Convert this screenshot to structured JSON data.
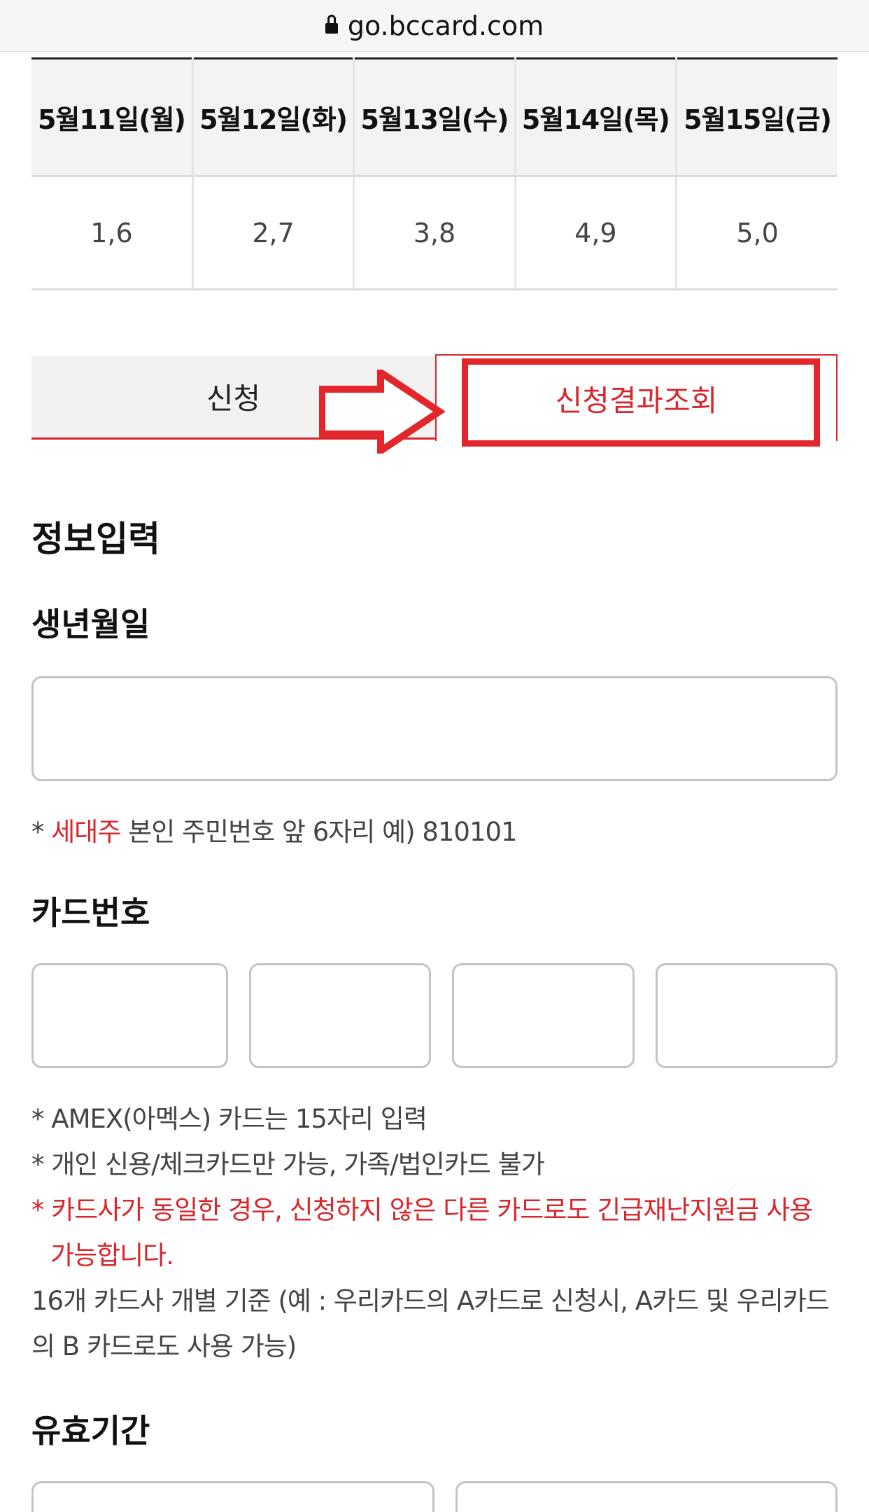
{
  "browser": {
    "url": "go.bccard.com"
  },
  "schedule": {
    "headers": [
      "5월11일(월)",
      "5월12일(화)",
      "5월13일(수)",
      "5월14일(목)",
      "5월15일(금)"
    ],
    "values": [
      "1,6",
      "2,7",
      "3,8",
      "4,9",
      "5,0"
    ]
  },
  "tabs": {
    "apply": "신청",
    "result": "신청결과조회"
  },
  "form": {
    "section_title": "정보입력",
    "birth": {
      "label": "생년월일",
      "value": "",
      "note_prefix": "* ",
      "note_highlight": "세대주",
      "note_rest": " 본인 주민번호 앞 6자리 예) 810101"
    },
    "card": {
      "label": "카드번호",
      "values": [
        "",
        "",
        "",
        ""
      ],
      "note1": "* AMEX(아멕스) 카드는 15자리 입력",
      "note2": "* 개인 신용/체크카드만 가능, 가족/법인카드 불가",
      "note3_line1": "* 카드사가 동일한 경우, 신청하지 않은 다른 카드로도 긴급재난지원금 사용",
      "note3_line2": "가능합니다.",
      "note4_line1": " 16개 카드사 개별 기준 (예 : 우리카드의 A카드로 신청시, A카드 및 우리카드",
      "note4_line2": "의 B 카드로도 사용 가능)"
    },
    "expiry": {
      "label": "유효기간",
      "values": [
        "",
        ""
      ]
    }
  },
  "colors": {
    "accent": "#d8262c",
    "highlight": "#e3262b"
  }
}
